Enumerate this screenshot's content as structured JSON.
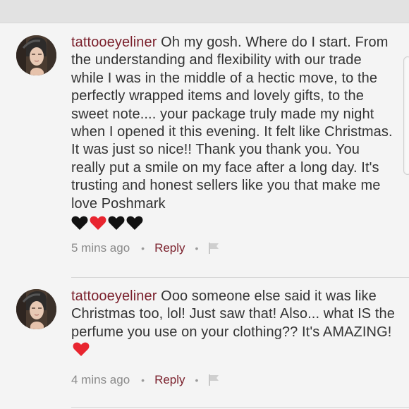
{
  "comments": [
    {
      "username": "tattooeyeliner",
      "text": "Oh my gosh. Where do I start. From the understanding and flexibility with our trade while I was in the middle of a hectic move, to the perfectly wrapped items and lovely gifts, to the sweet note.... your package truly made my night when I opened it this evening. It felt like Christmas. It was just so nice!! Thank you thank you. You really put a smile on my face after a long day. It's trusting and honest sellers like you that make me love Poshmark",
      "emoji": [
        "black-heart",
        "red-heart",
        "black-heart",
        "black-heart"
      ],
      "timestamp": "5 mins ago",
      "reply_label": "Reply",
      "separator": "•"
    },
    {
      "username": "tattooeyeliner",
      "text": "Ooo someone else said it was like Christmas too, lol! Just saw that! Also... what IS the perfume you use on your clothing?? It's AMAZING!",
      "emoji": [
        "red-heart"
      ],
      "timestamp": "4 mins ago",
      "reply_label": "Reply",
      "separator": "•"
    }
  ],
  "colors": {
    "background": "#f4f4f4",
    "text": "#333333",
    "username": "#7a1f2b",
    "reply": "#7a1f2b",
    "meta": "#8a8a8a",
    "heart_red": "#e8252f",
    "heart_black": "#111111"
  },
  "icons": {
    "flag": "flag-icon",
    "avatar": "avatar"
  }
}
